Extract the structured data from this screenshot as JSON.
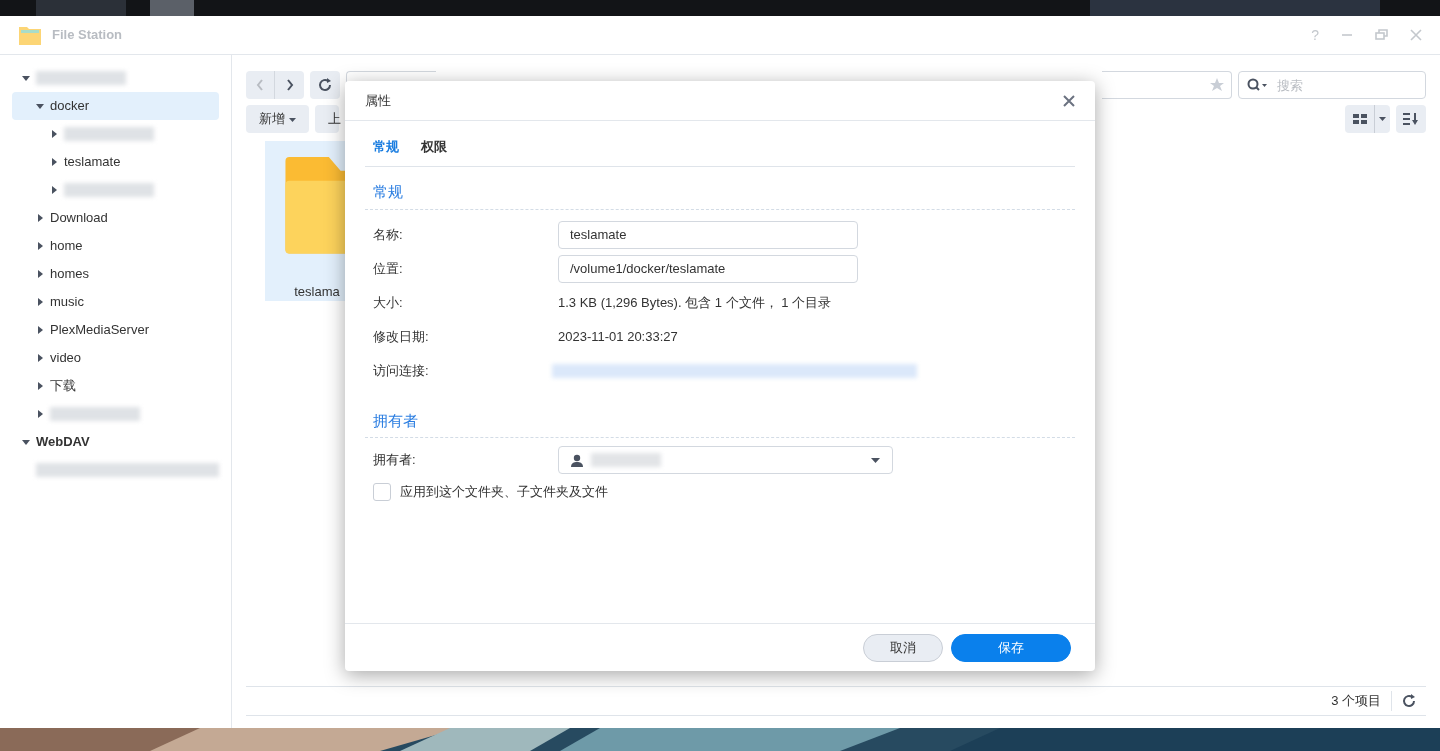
{
  "window": {
    "title": "File Station",
    "help": "?"
  },
  "tree": [
    {
      "kind": "redacted",
      "expanded": true,
      "selected": false,
      "children": [
        {
          "kind": "folder",
          "label": "docker",
          "expanded": true,
          "selected": true,
          "children": [
            {
              "kind": "redacted",
              "expanded": false,
              "selected": false
            },
            {
              "kind": "folder",
              "label": "teslamate",
              "expanded": false,
              "selected": false
            },
            {
              "kind": "redacted",
              "expanded": false,
              "selected": false
            }
          ]
        },
        {
          "kind": "folder",
          "label": "Download",
          "expanded": false,
          "selected": false
        },
        {
          "kind": "folder",
          "label": "home",
          "expanded": false,
          "selected": false
        },
        {
          "kind": "folder",
          "label": "homes",
          "expanded": false,
          "selected": false
        },
        {
          "kind": "folder",
          "label": "music",
          "expanded": false,
          "selected": false
        },
        {
          "kind": "folder",
          "label": "PlexMediaServer",
          "expanded": false,
          "selected": false
        },
        {
          "kind": "folder",
          "label": "video",
          "expanded": false,
          "selected": false
        },
        {
          "kind": "folder",
          "label": "下载",
          "expanded": false,
          "selected": false
        },
        {
          "kind": "redacted",
          "expanded": false,
          "selected": false
        }
      ]
    },
    {
      "kind": "group",
      "label": "WebDAV",
      "expanded": true,
      "selected": false,
      "children": [
        {
          "kind": "redacted-leaf",
          "expanded": false,
          "selected": false
        }
      ]
    }
  ],
  "toolbar": {
    "new_button": "新增",
    "upload_button_partial": "上",
    "search_placeholder": "搜索"
  },
  "files": [
    {
      "name": "teslama",
      "selected": true
    }
  ],
  "status_bar": {
    "count": "3 个项目"
  },
  "dialog": {
    "title": "属性",
    "tabs": [
      {
        "label": "常规",
        "selected": true
      },
      {
        "label": "权限",
        "selected": false
      }
    ],
    "section_general": "常规",
    "fields": [
      {
        "kind": "input",
        "label": "名称:",
        "value": "teslamate"
      },
      {
        "kind": "input",
        "label": "位置:",
        "value": "/volume1/docker/teslamate"
      },
      {
        "kind": "text",
        "label": "大小:",
        "value": "1.3 KB (1,296 Bytes). 包含 1 个文件， 1 个目录"
      },
      {
        "kind": "text",
        "label": "修改日期:",
        "value": "2023-11-01 20:33:27"
      },
      {
        "kind": "redacted",
        "label": "访问连接:"
      }
    ],
    "section_owner": "拥有者",
    "owner_label": "拥有者:",
    "apply_checkbox": {
      "label": "应用到这个文件夹、子文件夹及文件",
      "checked": false
    },
    "buttons": [
      {
        "kind": "secondary",
        "label": "取消"
      },
      {
        "kind": "primary",
        "label": "保存"
      }
    ]
  }
}
